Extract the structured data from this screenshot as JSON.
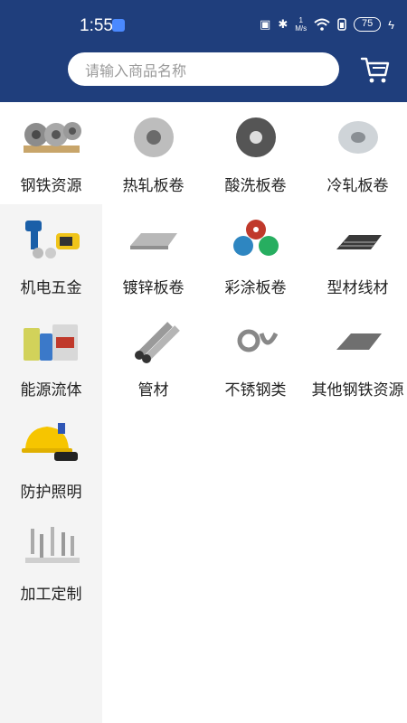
{
  "status": {
    "time": "1:55",
    "network_unit_top": "1",
    "network_unit_bottom": "M/s",
    "battery": "75"
  },
  "search": {
    "placeholder": "请输入商品名称"
  },
  "sidebar": {
    "items": [
      {
        "label": "钢铁资源",
        "icon": "steel-coils-icon",
        "active": true
      },
      {
        "label": "机电五金",
        "icon": "power-tools-icon",
        "active": false
      },
      {
        "label": "能源流体",
        "icon": "oil-containers-icon",
        "active": false
      },
      {
        "label": "防护照明",
        "icon": "helmet-flashlight-icon",
        "active": false
      },
      {
        "label": "加工定制",
        "icon": "fasteners-icon",
        "active": false
      }
    ]
  },
  "grid": {
    "items": [
      {
        "label": "热轧板卷",
        "icon": "hot-rolled-coil-icon"
      },
      {
        "label": "酸洗板卷",
        "icon": "pickled-coil-icon"
      },
      {
        "label": "冷轧板卷",
        "icon": "cold-rolled-coil-icon"
      },
      {
        "label": "镀锌板卷",
        "icon": "galvanized-sheet-icon"
      },
      {
        "label": "彩涂板卷",
        "icon": "color-coated-coil-icon"
      },
      {
        "label": "型材线材",
        "icon": "steel-bars-icon"
      },
      {
        "label": "管材",
        "icon": "steel-pipes-icon"
      },
      {
        "label": "不锈钢类",
        "icon": "stainless-icon"
      },
      {
        "label": "其他钢铁资源",
        "icon": "steel-plate-icon"
      }
    ]
  },
  "colors": {
    "header": "#1f3e7c",
    "sidebar_bg": "#f4f4f4",
    "active_bg": "#ffffff"
  }
}
